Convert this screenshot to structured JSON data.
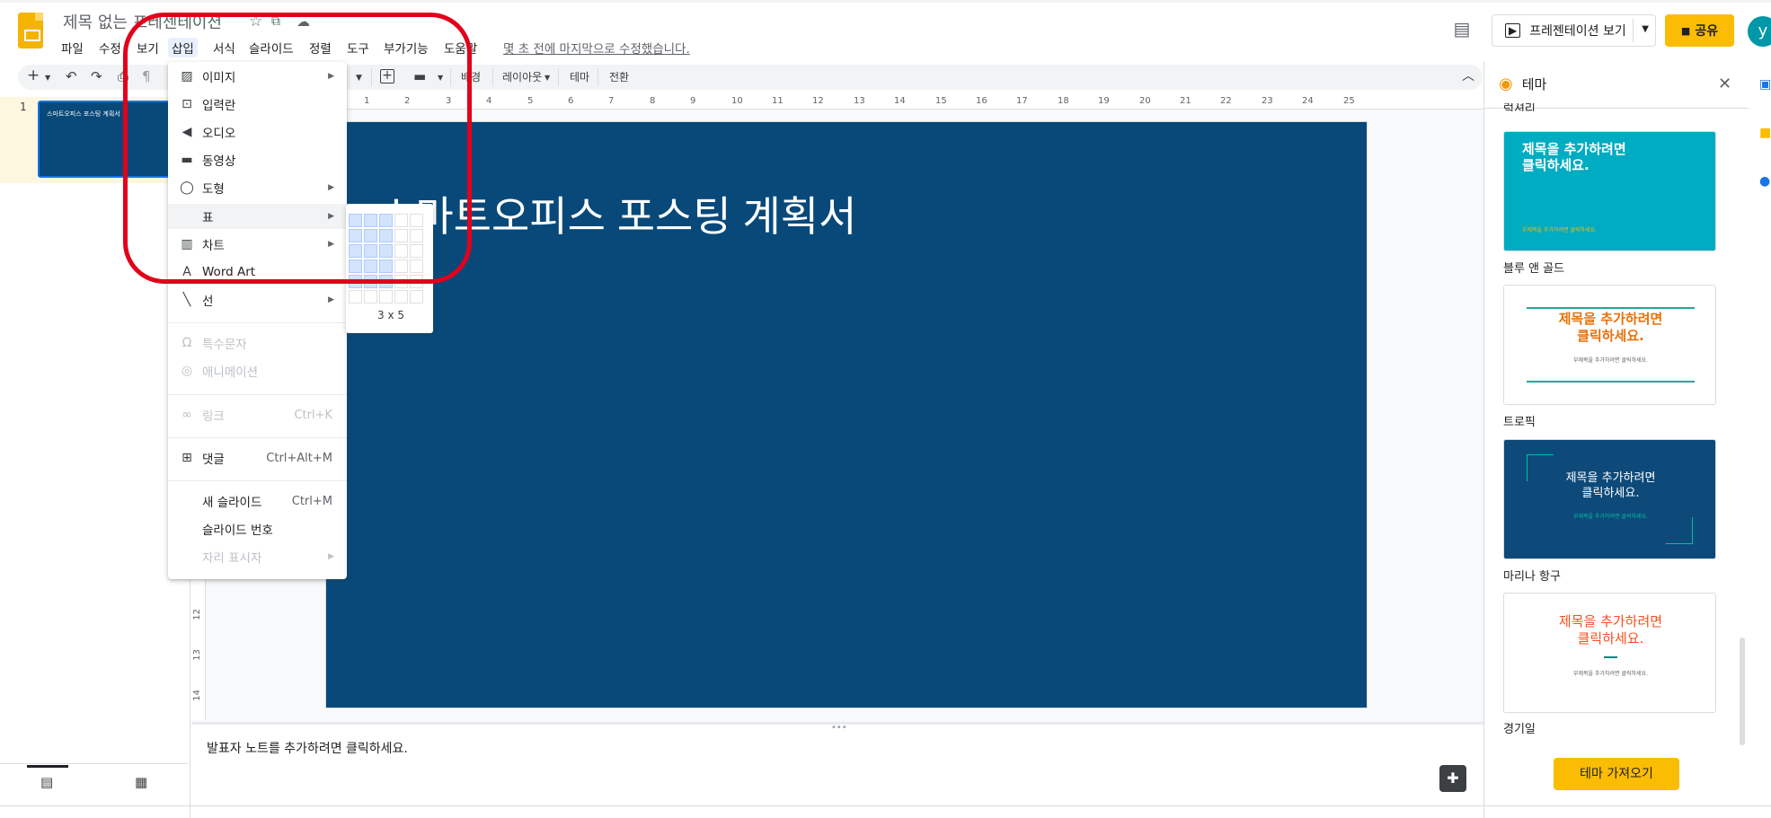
{
  "header": {
    "doc_title": "제목 없는 프레젠테이션",
    "last_edit": "몇 초 전에 마지막으로 수정했습니다.",
    "menus": [
      "파일",
      "수정",
      "보기",
      "삽입",
      "서식",
      "슬라이드",
      "정렬",
      "도구",
      "부가기능",
      "도움말"
    ],
    "present_label": "프레젠테이션 보기",
    "share_label": "공유",
    "avatar_letter": "y"
  },
  "toolbar": {
    "background_label": "배경",
    "layout_label": "레이아웃",
    "theme_label": "테마",
    "transition_label": "전환"
  },
  "filmstrip": {
    "slide_number": "1",
    "thumb_title": "스마트오피스 포스팅 계획서"
  },
  "slide": {
    "title": "스마트오피스 포스팅 계획서"
  },
  "notes": {
    "placeholder": "발표자 노트를 추가하려면 클릭하세요."
  },
  "insert_menu": {
    "items": [
      {
        "label": "이미지",
        "icon": "image-icon",
        "submenu": true
      },
      {
        "label": "입력란",
        "icon": "textbox-icon"
      },
      {
        "label": "오디오",
        "icon": "audio-icon"
      },
      {
        "label": "동영상",
        "icon": "video-icon"
      },
      {
        "label": "도형",
        "icon": "shape-icon",
        "submenu": true
      },
      {
        "label": "표",
        "submenu": true,
        "highlighted": true
      },
      {
        "label": "차트",
        "icon": "chart-icon",
        "submenu": true
      },
      {
        "label": "Word Art",
        "icon": "wordart-icon"
      },
      {
        "label": "선",
        "icon": "line-icon",
        "submenu": true
      },
      {
        "label": "특수문자",
        "icon": "omega-icon",
        "disabled": true
      },
      {
        "label": "애니메이션",
        "icon": "animation-icon",
        "disabled": true
      },
      {
        "label": "링크",
        "icon": "link-icon",
        "shortcut": "Ctrl+K",
        "disabled": true
      },
      {
        "label": "댓글",
        "icon": "comment-add-icon",
        "shortcut": "Ctrl+Alt+M"
      },
      {
        "label": "새 슬라이드",
        "shortcut": "Ctrl+M"
      },
      {
        "label": "슬라이드 번호"
      },
      {
        "label": "자리 표시자",
        "submenu": true,
        "disabled": true
      }
    ]
  },
  "table_picker": {
    "size_label": "3 x 5",
    "selected_cols": 3,
    "selected_rows": 5
  },
  "theme_panel": {
    "title": "테마",
    "partial_label": "럭셔리",
    "themes": [
      {
        "name": "블루 앤 골드",
        "title_text": "제목을 추가하려면\n클릭하세요.",
        "sub_text": "부제목을 추가하려면 클릭하세요.",
        "bg": "#00acc1",
        "fg": "#ffffff",
        "accent": "#fbbc04"
      },
      {
        "name": "트로픽",
        "title_text": "제목을 추가하려면\n클릭하세요.",
        "sub_text": "부제목을 추가하려면 클릭하세요.",
        "bg": "#ffffff",
        "fg": "#e8710a",
        "accent": "#26a69a"
      },
      {
        "name": "마리나 항구",
        "title_text": "제목을 추가하려면\n클릭하세요.",
        "sub_text": "부제목을 추가하려면 클릭하세요.",
        "bg": "#0d4a7a",
        "fg": "#ffffff",
        "accent": "#00bfa5"
      },
      {
        "name": "경기일",
        "title_text": "제목을 추가하려면\n클릭하세요.",
        "sub_text": "부제목을 추가하려면 클릭하세요.",
        "bg": "#ffffff",
        "fg": "#f4511e",
        "accent": "#00897b"
      }
    ],
    "import_label": "테마 가져오기"
  },
  "colors": {
    "slide_bg": "#08497a",
    "accent": "#fbbc04",
    "annotation": "#e2001a"
  }
}
